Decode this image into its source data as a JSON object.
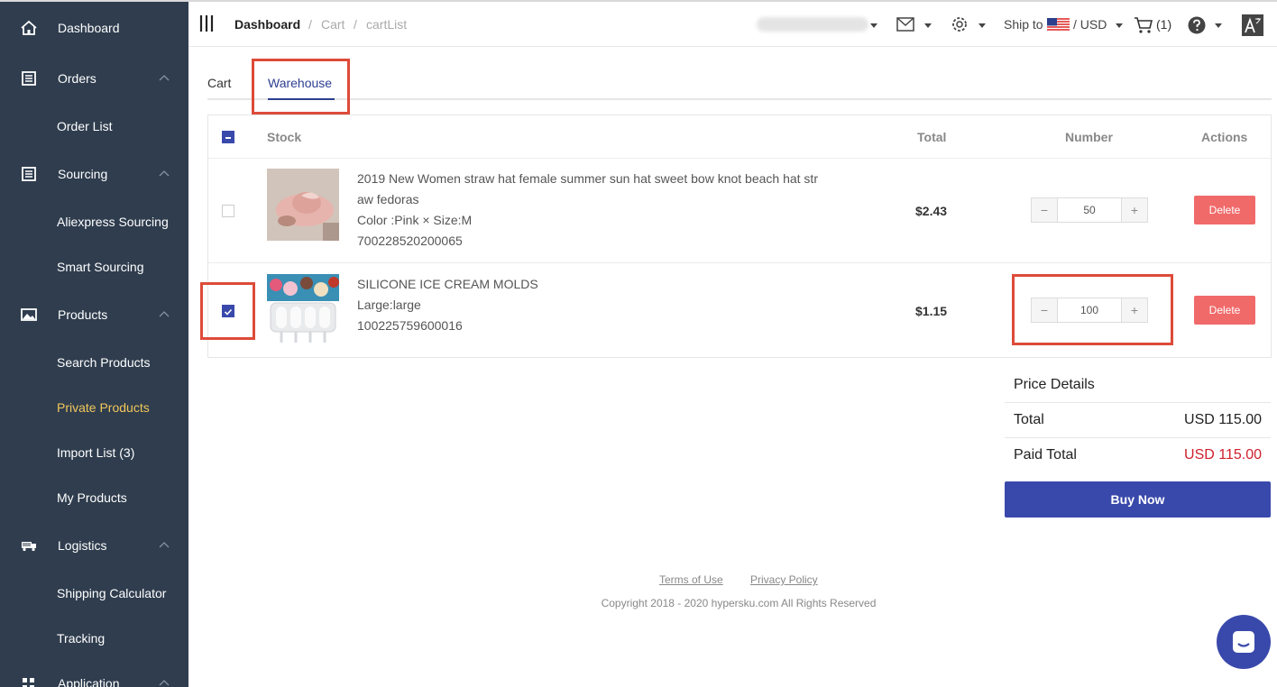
{
  "sidebar": {
    "items": [
      {
        "label": "Dashboard"
      },
      {
        "label": "Orders"
      },
      {
        "label": "Order List"
      },
      {
        "label": "Sourcing"
      },
      {
        "label": "Aliexpress Sourcing"
      },
      {
        "label": "Smart Sourcing"
      },
      {
        "label": "Products"
      },
      {
        "label": "Search Products"
      },
      {
        "label": "Private Products"
      },
      {
        "label": "Import List (3)"
      },
      {
        "label": "My Products"
      },
      {
        "label": "Logistics"
      },
      {
        "label": "Shipping Calculator"
      },
      {
        "label": "Tracking"
      },
      {
        "label": "Application"
      }
    ],
    "active_color": "#f1c75b",
    "bg": "#2f3d4e"
  },
  "header": {
    "breadcrumb": [
      "Dashboard",
      "/",
      "Cart",
      "/",
      "cartList"
    ],
    "ship_to": "Ship to",
    "currency": "/ USD",
    "cart_count": "(1)"
  },
  "tabs": [
    {
      "label": "Cart"
    },
    {
      "label": "Warehouse"
    }
  ],
  "table": {
    "headers": [
      "Stock",
      "Total",
      "Number",
      "Actions"
    ],
    "rows": [
      {
        "title_line1": "2019 New Women straw hat female summer sun hat sweet bow knot beach hat str",
        "title_line2": "aw fedoras",
        "variant": "Color :Pink × Size:M",
        "sku": "700228520200065",
        "total": "$2.43",
        "quantity": "50",
        "delete_label": "Delete",
        "checked": false
      },
      {
        "title_line1": "SILICONE ICE CREAM MOLDS",
        "variant": "Large:large",
        "sku": "100225759600016",
        "total": "$1.15",
        "quantity": "100",
        "delete_label": "Delete",
        "checked": true
      }
    ]
  },
  "price_details": {
    "heading": "Price Details",
    "total_label": "Total",
    "total_value": "USD 115.00",
    "paid_label": "Paid Total",
    "paid_value": "USD 115.00",
    "buy_label": "Buy Now"
  },
  "footer": {
    "terms": "Terms of Use",
    "privacy": "Privacy Policy",
    "copyright": "Copyright 2018 - 2020 hypersku.com All Rights Reserved"
  },
  "colors": {
    "accent": "#3949ab",
    "delete": "#f06a6a",
    "highlight_box": "#dd4b39",
    "paid_total": "#d0202e"
  }
}
